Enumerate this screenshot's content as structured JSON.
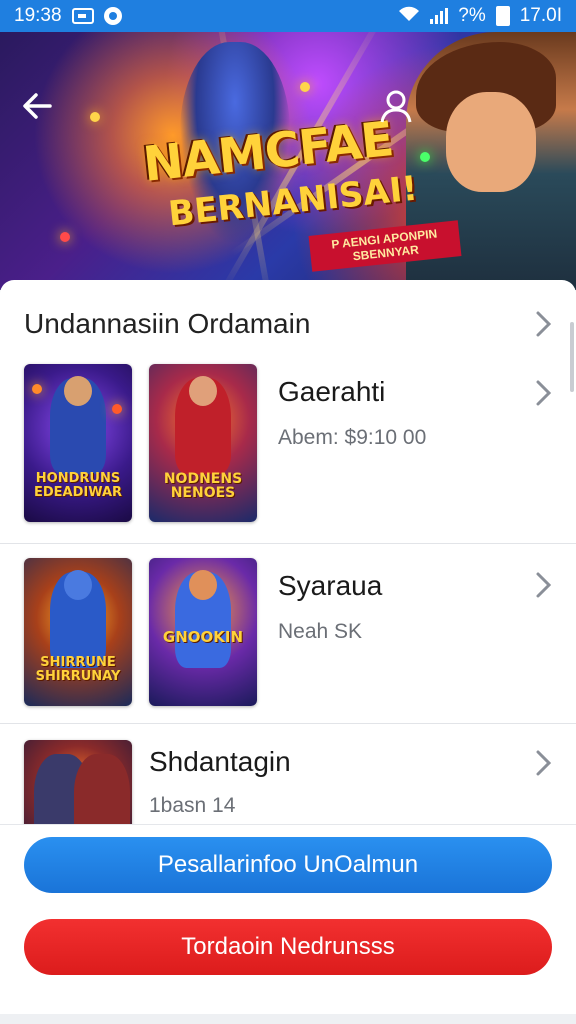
{
  "status_bar": {
    "time": "19:38",
    "battery": "?%",
    "clock_right": "17.0I"
  },
  "hero": {
    "title": "NAMCFAE",
    "subtitle": "BERNANISAI!",
    "tag": "P AENGI APONPIN SBENNYAR"
  },
  "section": {
    "title": "Undannasiin Ordamain"
  },
  "items": [
    {
      "title": "Gaerahti",
      "subtitle": "Abem: $9:10 00",
      "thumb1_label": "HONDRUNS EDEADIWAR",
      "thumb2_label": "NODNENS NENOES"
    },
    {
      "title": "Syaraua",
      "subtitle": "Neah SK",
      "thumb1_label": "SHIRRUNE SHIRRUNAY",
      "thumb2_label": "GNOOKIN"
    },
    {
      "title": "Shdantagin",
      "subtitle": "1basn 14",
      "thumb1_label": ""
    }
  ],
  "buttons": {
    "primary": "Pesallarinfoo UnOalmun",
    "danger": "Tordaoin Nedrunsss"
  },
  "colors": {
    "status_bar": "#1f7fe0",
    "primary_button": "#1f82e6",
    "danger_button": "#e82424"
  }
}
